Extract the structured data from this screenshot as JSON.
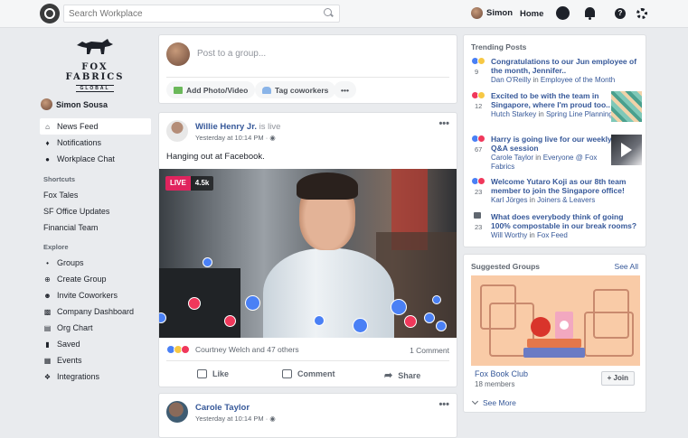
{
  "topbar": {
    "search_placeholder": "Search Workplace",
    "user_name": "Simon",
    "home_label": "Home"
  },
  "brand": {
    "name": "FOX FABRICS",
    "sub": "GLOBAL"
  },
  "sidebar": {
    "user_name": "Simon Sousa",
    "main_items": [
      {
        "label": "News Feed",
        "icon": "home-icon"
      },
      {
        "label": "Notifications",
        "icon": "bell-icon"
      },
      {
        "label": "Workplace Chat",
        "icon": "chat-icon"
      }
    ],
    "shortcuts_label": "Shortcuts",
    "shortcuts": [
      "Fox Tales",
      "SF Office Updates",
      "Financial Team"
    ],
    "explore_label": "Explore",
    "explore": [
      {
        "label": "Groups",
        "icon": "groups-icon"
      },
      {
        "label": "Create Group",
        "icon": "plus-icon"
      },
      {
        "label": "Invite Coworkers",
        "icon": "invite-icon"
      },
      {
        "label": "Company Dashboard",
        "icon": "dashboard-icon"
      },
      {
        "label": "Org Chart",
        "icon": "org-chart-icon"
      },
      {
        "label": "Saved",
        "icon": "bookmark-icon"
      },
      {
        "label": "Events",
        "icon": "calendar-icon"
      },
      {
        "label": "Integrations",
        "icon": "puzzle-icon"
      }
    ]
  },
  "composer": {
    "placeholder": "Post to a group...",
    "add_photo": "Add Photo/Video",
    "tag_coworkers": "Tag coworkers",
    "more": "•••"
  },
  "post": {
    "author": "Willie Henry Jr.",
    "status": "is live",
    "meta": "Yesterday at 10:14 PM ·",
    "text": "Hanging out at Facebook.",
    "live_label": "LIVE",
    "viewers": "4.5k",
    "reactions_text": "Courtney Welch and 47 others",
    "comment_count": "1 Comment",
    "like_label": "Like",
    "comment_label": "Comment",
    "share_label": "Share"
  },
  "post2": {
    "author": "Carole Taylor",
    "meta": "Yesterday at 10:14 PM ·"
  },
  "trending": {
    "title": "Trending Posts",
    "items": [
      {
        "count": "9",
        "title": "Congratulations to our Jun employee of the month, Jennifer..",
        "author": "Dan O'Reilly",
        "in": "in",
        "group": "Employee of the Month"
      },
      {
        "count": "12",
        "title": "Excited to be with the team in Singapore, where I'm proud too..",
        "author": "Hutch Starkey",
        "in": "in",
        "group": "Spring Line Planning"
      },
      {
        "count": "67",
        "title": "Harry is going live for our weekly Q&A session",
        "author": "Carole Taylor",
        "in": "in",
        "group": "Everyone @ Fox Fabrics"
      },
      {
        "count": "23",
        "title": "Welcome Yutaro Koji as our 8th team member to join the Singapore office!",
        "author": "Karl Jörges",
        "in": "in",
        "group": "Joiners & Leavers"
      },
      {
        "count": "23",
        "title": "What does everybody think of going 100% compostable in our break rooms?",
        "author": "Will Worthy",
        "in": "in",
        "group": "Fox Feed"
      }
    ]
  },
  "groups": {
    "title": "Suggested Groups",
    "see_all": "See All",
    "group_name": "Fox Book Club",
    "members": "18 members",
    "join_label": "+ Join",
    "see_more": "See More"
  }
}
